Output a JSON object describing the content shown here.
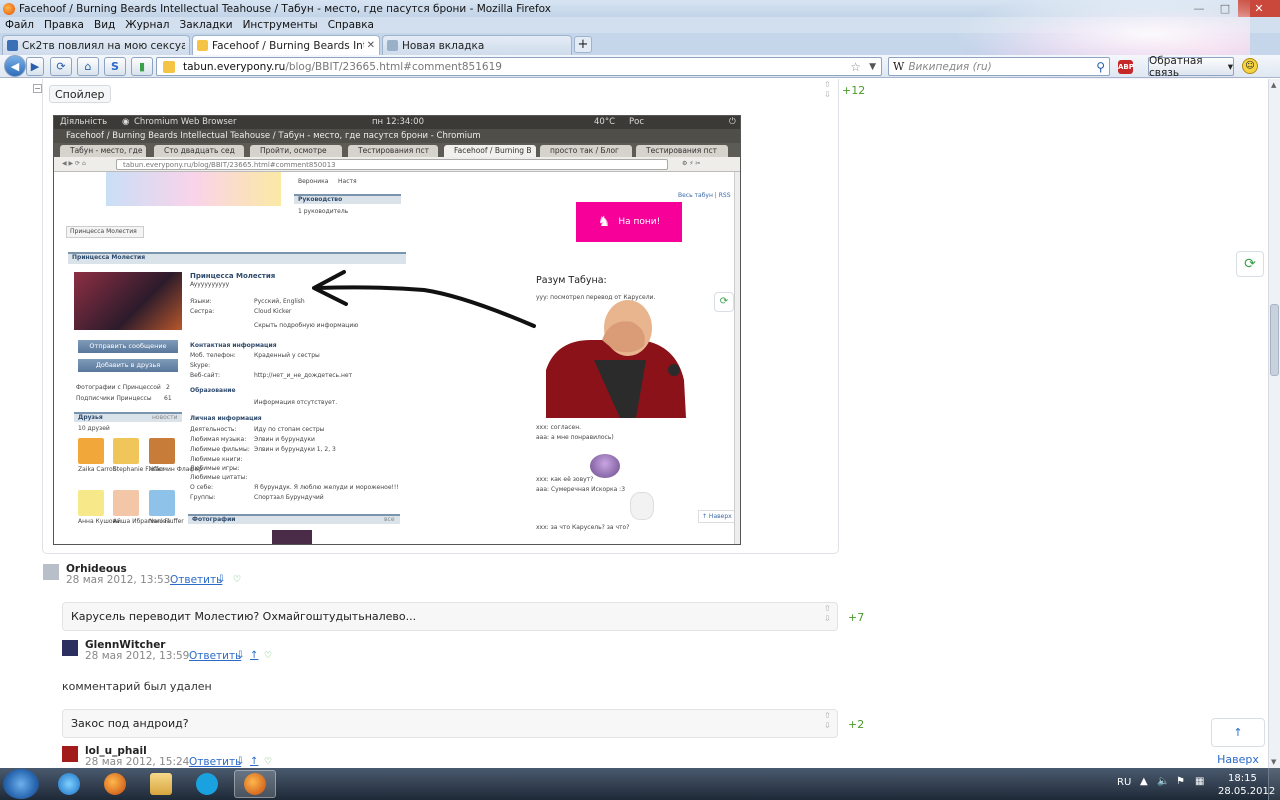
{
  "window": {
    "title": "Facehoof / Burning Beards Intellectual Teahouse / Табун - место, где пасутся брони - Mozilla Firefox",
    "controls": [
      "—",
      "□",
      "✕"
    ]
  },
  "menu": [
    "Файл",
    "Правка",
    "Вид",
    "Журнал",
    "Закладки",
    "Инструменты",
    "Справка"
  ],
  "tabs": [
    {
      "label": "Ск2тв повлиял на мою сексуальну...",
      "active": false
    },
    {
      "label": "Facehoof / Burning Beards Intellectua...",
      "active": true
    },
    {
      "label": "Новая вкладка",
      "active": false
    }
  ],
  "nav": {
    "url_domain": "tabun.everypony.ru",
    "url_path": "/blog/BBIT/23665.html#comment851619",
    "search_engine": "W",
    "search_placeholder": "Википедия (ru)",
    "abp": "ABP",
    "feedback": "Обратная связь"
  },
  "spoiler": {
    "label": "Спойлер",
    "rating": "+12"
  },
  "inner_shot": {
    "activities": "Діяльність",
    "app": "Chromium Web Browser",
    "clock": "пн 12:34:00",
    "temp": "40°C",
    "lang": "Рос",
    "window_title": "Facehoof / Burning Beards Intellectual Teahouse / Табун - место, где пасутся брони - Chromium",
    "tabs": [
      "Табун - место, где",
      "Сто двадцать сед",
      "Пройти, осмотре",
      "Тестирования пст",
      "Facehoof / Burning B",
      "просто так / Блог",
      "Тестирования пст"
    ],
    "url": "tabun.everypony.ru/blog/BBIT/23665.html#comment850013",
    "left": {
      "veronika": "Вероника",
      "nastya": "Настя",
      "rukovodstvo": "Руководство",
      "one_leader": "1 руководитель",
      "profile_tab": "Принцесса Молестия",
      "panel_title": "Принцесса Молестия",
      "name": "Принцесса Молестия",
      "status": "Ayyyyyyyyyy",
      "langs_label": "Языки:",
      "langs_value": "Русский, English",
      "sisters_label": "Сестра:",
      "sisters_value": "Cloud Kicker",
      "hide_info": "Скрыть подробную информацию",
      "contact_head": "Контактная информация",
      "phone_label": "Моб. телефон:",
      "phone_value": "Краденный у сестры",
      "skype_label": "Skype:",
      "site_label": "Веб-сайт:",
      "site_value": "http://нет_и_не_дождетесь.нет",
      "education_head": "Образование",
      "education_value": "Информация отсутствует.",
      "personal_head": "Личная информация",
      "activity_label": "Деятельность:",
      "activity_value": "Иду по стопам сестры",
      "music_label": "Любимая музыка:",
      "music_value": "Элвин и бурундуки",
      "films_label": "Любимые фильмы:",
      "films_value": "Элвин и бурундуки 1, 2, 3",
      "books_label": "Любимые книги:",
      "games_label": "Любимые игры:",
      "quotes_label": "Любимые цитаты:",
      "about_label": "О себе:",
      "about_value": "Я бурундук. Я люблю желуди и мороженое!!!",
      "groups_label": "Группы:",
      "groups_value": "Спортзал Бурундучий",
      "send_msg": "Отправить сообщение",
      "add_friend": "Добавить в друзья",
      "photos_of": "Фотографии с Принцессой",
      "photos_count": "2",
      "subscribers": "Подписчики Принцессы",
      "subscribers_count": "61",
      "friends_head": "Друзья",
      "friends_new": "новости",
      "friends_count": "10 друзей",
      "friends": [
        "Zaika Carroll",
        "Stephanie Fluffer",
        "Жасмин Флафер",
        "Анна Кушова",
        "Айша Ибрагимова",
        "Nani Fluffer"
      ],
      "photos_head": "Фотографии",
      "photos_all": "все"
    },
    "right": {
      "links": "Весь табун | RSS",
      "pink_button": "На пони!",
      "mind_title": "Разум Табуна:",
      "line1": "yyy: посмотрел перевод от Карусели.",
      "line2": "xxx: согласен.",
      "line3": "aaa: а мне понравилось)",
      "line4": "xxx: как её зовут?",
      "line5": "aaa: Сумеречная Искорка :3",
      "line6": "xxx: за что Карусель? за что?",
      "top_link": "↑ Наверх"
    }
  },
  "comments": [
    {
      "user": "Orhideous",
      "date": "28 мая 2012, 13:53",
      "reply": "Ответить"
    },
    {
      "text": "Карусель переводит Молестию? Охмайгоштудытьналево...",
      "rating": "+7"
    },
    {
      "user": "GlennWitcher",
      "date": "28 мая 2012, 13:59",
      "reply": "Ответить"
    },
    {
      "deleted": "комментарий был удален"
    },
    {
      "text": "Закос под андроид?",
      "rating": "+2"
    },
    {
      "user": "lol_u_phail",
      "date": "28 мая 2012, 15:24",
      "reply": "Ответить"
    }
  ],
  "sidebar": {
    "top_link": "↑ Наверх"
  },
  "taskbar": {
    "lang": "RU",
    "time": "18:15",
    "date": "28.05.2012"
  },
  "colors": {
    "accent_link": "#2a6ac9",
    "rating_green": "#4a9a2a",
    "pink_button": "#f7009a"
  }
}
